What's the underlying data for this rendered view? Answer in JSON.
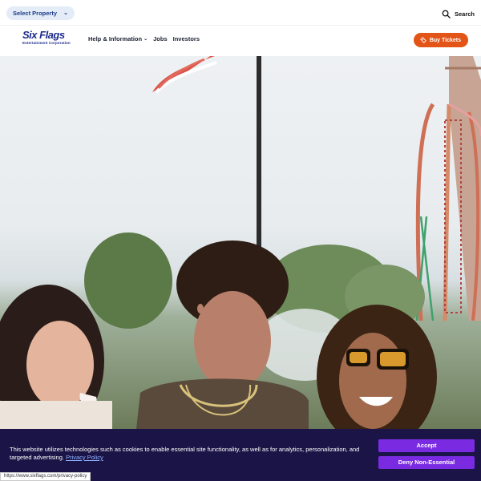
{
  "topbar": {
    "select_property": "Select Property",
    "search_label": "Search"
  },
  "nav": {
    "logo_brand": "Six Flags",
    "logo_sub": "Entertainment Corporation",
    "links": [
      "Help & Information",
      "Jobs",
      "Investors"
    ],
    "buy_tickets": "Buy Tickets"
  },
  "hero": {
    "image_alt": "Group of friends laughing in front of roller coaster"
  },
  "cookie": {
    "text": "This website utilizes technologies such as cookies to enable essential site functionality, as well as for analytics, personalization, and targeted advertising.",
    "link": "Privacy Policy",
    "accept": "Accept",
    "deny": "Deny Non-Essential"
  },
  "status_url": "https://www.sixflags.com/privacy-policy",
  "colors": {
    "brand_blue": "#1d2b8c",
    "buy_orange": "#e35417",
    "cookie_bg": "#1b1446",
    "cookie_button": "#7a2be2"
  }
}
